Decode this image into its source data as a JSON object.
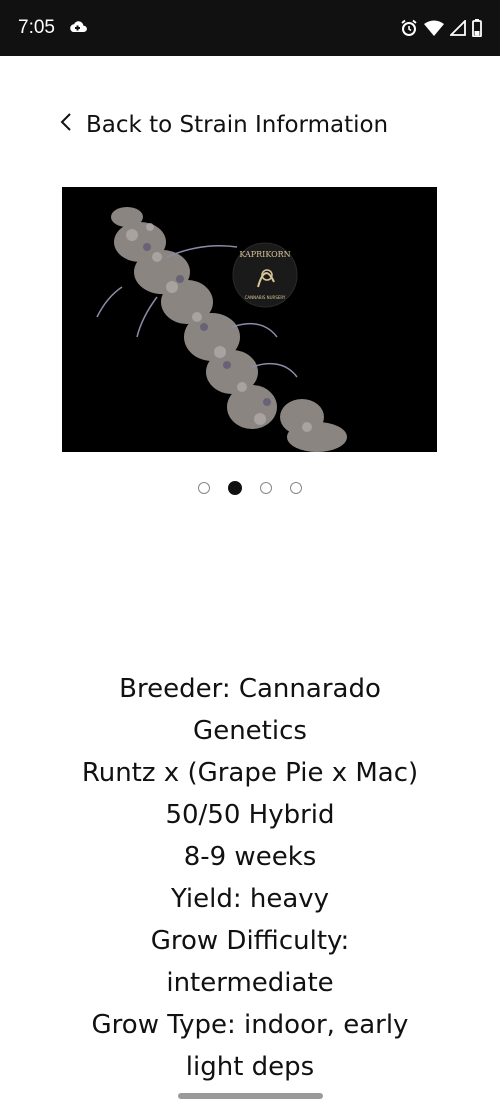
{
  "status_bar": {
    "time": "7:05",
    "icons": [
      "cloud-game-icon",
      "alarm-icon",
      "wifi-icon",
      "signal-icon",
      "battery-icon"
    ]
  },
  "navigation": {
    "back_label": "Back to Strain Information"
  },
  "carousel": {
    "image_logo_text": "KAPRIKORN",
    "image_logo_subtext": "CANNABIS NURSERY",
    "slide_count": 4,
    "active_index": 1
  },
  "strain_info": {
    "lines": [
      "Breeder: Cannarado",
      "Genetics",
      "Runtz x (Grape Pie x Mac)",
      "50/50 Hybrid",
      "8-9 weeks",
      "Yield: heavy",
      "Grow Difficulty:",
      "intermediate",
      "Grow Type: indoor, early",
      "light deps"
    ]
  }
}
